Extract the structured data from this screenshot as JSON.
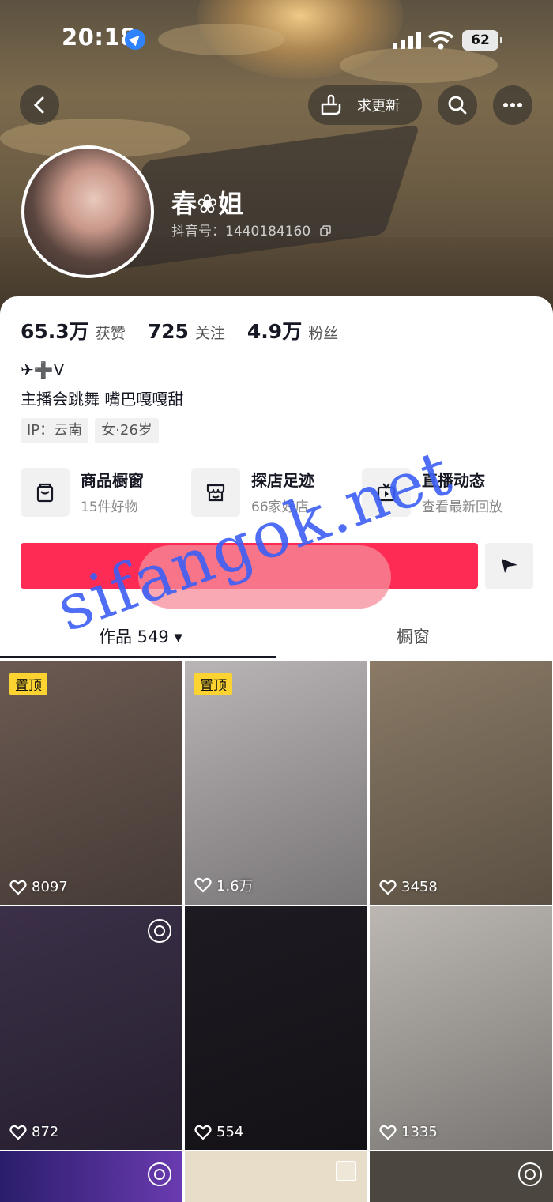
{
  "status": {
    "time": "20:18",
    "battery": "62"
  },
  "header": {
    "request_update_label": "求更新"
  },
  "profile": {
    "name": "春❀姐",
    "douyin_id": "抖音号：1440184160",
    "stats": [
      {
        "num": "65.3万",
        "label": "获赞"
      },
      {
        "num": "725",
        "label": "关注"
      },
      {
        "num": "4.9万",
        "label": "粉丝"
      }
    ],
    "bio_line1": "✈➕V",
    "bio_line2": "主播会跳舞 嘴巴嘎嘎甜",
    "tags": [
      "IP：云南",
      "女·26岁"
    ]
  },
  "services": [
    {
      "title": "商品橱窗",
      "sub": "15件好物"
    },
    {
      "title": "探店足迹",
      "sub": "66家好店"
    },
    {
      "title": "直播动态",
      "sub": "查看最新回放"
    }
  ],
  "tabs": [
    {
      "label": "作品 549 ▾"
    },
    {
      "label": "橱窗"
    }
  ],
  "watermark": "sifangok.net",
  "videos": [
    {
      "likes": "8097",
      "pinned": "置顶",
      "bg": "#6b5a52"
    },
    {
      "likes": "1.6万",
      "pinned": "置顶",
      "bg": "#b9b4b6"
    },
    {
      "likes": "3458",
      "pinned": "",
      "bg": "#8a7a66"
    },
    {
      "likes": "872",
      "pinned": "",
      "bg": "#3b3048"
    },
    {
      "likes": "554",
      "pinned": "",
      "bg": "#1e1a22"
    },
    {
      "likes": "1335",
      "pinned": "",
      "bg": "#bcb7b2"
    }
  ]
}
